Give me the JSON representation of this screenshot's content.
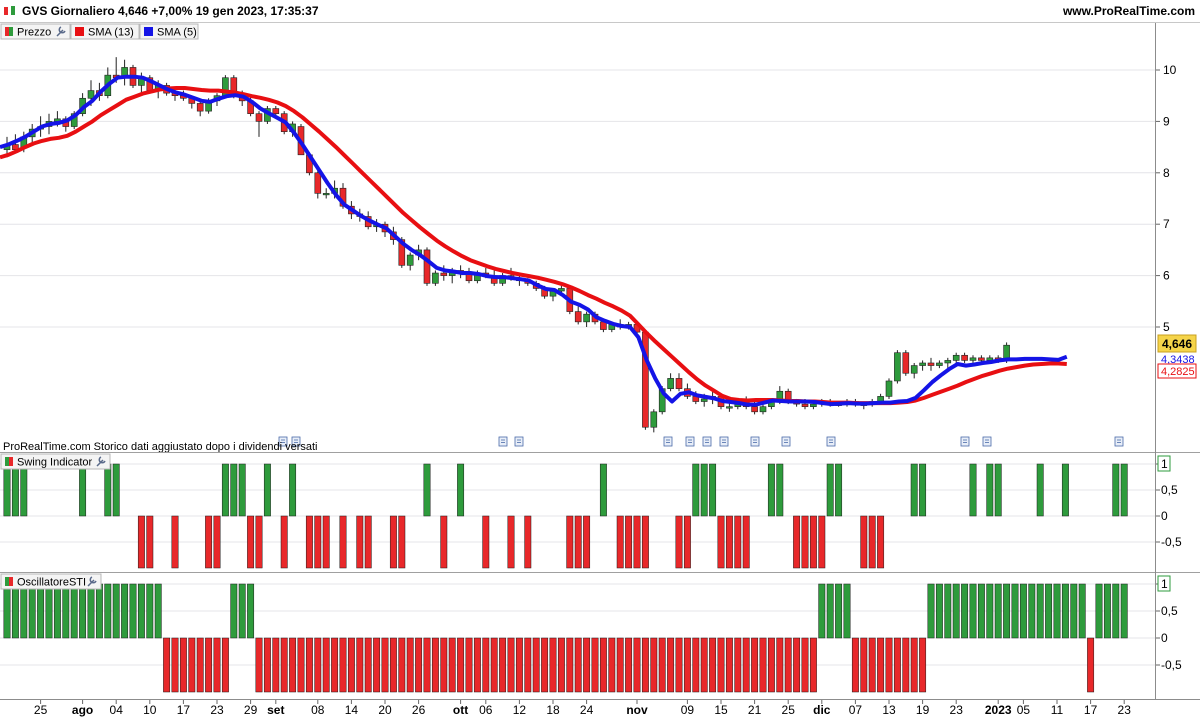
{
  "header": {
    "title": "GVS Giornaliero 4,646 +7,00% 19 gen 2023, 17:35:37",
    "site": "www.ProRealTime.com"
  },
  "colors": {
    "up": "#2e9b3c",
    "down": "#e8282a",
    "sma13": "#e80f12",
    "sma5": "#1414e6",
    "grid": "#e4e4e8",
    "price_label_bg": "#f5d44a"
  },
  "price_panel": {
    "legend": [
      {
        "label": "Prezzo",
        "icon": "candle-legend-icon",
        "wrench": true
      },
      {
        "label": "SMA (13)",
        "color": "#e80f12"
      },
      {
        "label": "SMA (5)",
        "color": "#1414e6"
      }
    ],
    "footnote": "ProRealTime.com  Storico dati aggiustato dopo i dividendi versati",
    "price_tag": "4,646",
    "sma5_tag": "4,3438",
    "sma13_tag": "4,2825",
    "y_ticks": [
      "10",
      "9",
      "8",
      "7",
      "6",
      "5"
    ]
  },
  "swing_panel": {
    "title": "Swing Indicator",
    "y_ticks": [
      "1",
      "0,5",
      "0",
      "-0,5"
    ]
  },
  "sti_panel": {
    "title": "OscillatoreSTI",
    "y_ticks": [
      "1",
      "0,5",
      "0",
      "-0,5"
    ]
  },
  "x_axis": {
    "labels": [
      {
        "text": "25",
        "bar": 4,
        "bold": false
      },
      {
        "text": "ago",
        "bar": 9,
        "bold": true
      },
      {
        "text": "04",
        "bar": 13,
        "bold": false
      },
      {
        "text": "10",
        "bar": 17,
        "bold": false
      },
      {
        "text": "17",
        "bar": 21,
        "bold": false
      },
      {
        "text": "23",
        "bar": 25,
        "bold": false
      },
      {
        "text": "29",
        "bar": 29,
        "bold": false
      },
      {
        "text": "set",
        "bar": 32,
        "bold": true
      },
      {
        "text": "08",
        "bar": 37,
        "bold": false
      },
      {
        "text": "14",
        "bar": 41,
        "bold": false
      },
      {
        "text": "20",
        "bar": 45,
        "bold": false
      },
      {
        "text": "26",
        "bar": 49,
        "bold": false
      },
      {
        "text": "ott",
        "bar": 54,
        "bold": true
      },
      {
        "text": "06",
        "bar": 57,
        "bold": false
      },
      {
        "text": "12",
        "bar": 61,
        "bold": false
      },
      {
        "text": "18",
        "bar": 65,
        "bold": false
      },
      {
        "text": "24",
        "bar": 69,
        "bold": false
      },
      {
        "text": "nov",
        "bar": 75,
        "bold": true
      },
      {
        "text": "09",
        "bar": 81,
        "bold": false
      },
      {
        "text": "15",
        "bar": 85,
        "bold": false
      },
      {
        "text": "21",
        "bar": 89,
        "bold": false
      },
      {
        "text": "25",
        "bar": 93,
        "bold": false
      },
      {
        "text": "dic",
        "bar": 97,
        "bold": true
      },
      {
        "text": "07",
        "bar": 101,
        "bold": false
      },
      {
        "text": "13",
        "bar": 105,
        "bold": false
      },
      {
        "text": "19",
        "bar": 109,
        "bold": false
      },
      {
        "text": "23",
        "bar": 113,
        "bold": false
      },
      {
        "text": "2023",
        "bar": 118,
        "bold": true
      },
      {
        "text": "05",
        "bar": 121,
        "bold": false
      },
      {
        "text": "11",
        "bar": 125,
        "bold": false
      },
      {
        "text": "17",
        "bar": 129,
        "bold": false
      },
      {
        "text": "23",
        "bar": 133,
        "bold": false
      }
    ]
  },
  "chart_data": {
    "type": "candlestick",
    "title": "GVS Giornaliero",
    "ylim": [
      3.0,
      10.5
    ],
    "ohlc": [
      [
        8.45,
        8.7,
        8.3,
        8.55
      ],
      [
        8.55,
        8.75,
        8.4,
        8.45
      ],
      [
        8.5,
        8.8,
        8.4,
        8.7
      ],
      [
        8.7,
        8.95,
        8.55,
        8.85
      ],
      [
        8.85,
        9.1,
        8.7,
        8.9
      ],
      [
        8.9,
        9.15,
        8.75,
        9.0
      ],
      [
        9.0,
        9.2,
        8.9,
        9.05
      ],
      [
        9.05,
        9.1,
        8.8,
        8.9
      ],
      [
        8.9,
        9.2,
        8.85,
        9.15
      ],
      [
        9.15,
        9.55,
        9.1,
        9.45
      ],
      [
        9.45,
        9.8,
        9.3,
        9.6
      ],
      [
        9.6,
        9.75,
        9.4,
        9.5
      ],
      [
        9.5,
        10.05,
        9.45,
        9.9
      ],
      [
        9.9,
        10.25,
        9.75,
        9.85
      ],
      [
        9.85,
        10.2,
        9.7,
        10.05
      ],
      [
        10.05,
        10.1,
        9.65,
        9.7
      ],
      [
        9.7,
        9.95,
        9.55,
        9.85
      ],
      [
        9.85,
        9.9,
        9.55,
        9.6
      ],
      [
        9.6,
        9.8,
        9.45,
        9.7
      ],
      [
        9.7,
        9.75,
        9.5,
        9.55
      ],
      [
        9.55,
        9.65,
        9.4,
        9.5
      ],
      [
        9.5,
        9.6,
        9.4,
        9.45
      ],
      [
        9.45,
        9.5,
        9.25,
        9.35
      ],
      [
        9.35,
        9.4,
        9.1,
        9.2
      ],
      [
        9.2,
        9.45,
        9.15,
        9.4
      ],
      [
        9.4,
        9.55,
        9.3,
        9.5
      ],
      [
        9.5,
        9.9,
        9.45,
        9.85
      ],
      [
        9.85,
        9.9,
        9.45,
        9.5
      ],
      [
        9.5,
        9.6,
        9.3,
        9.4
      ],
      [
        9.4,
        9.5,
        9.1,
        9.15
      ],
      [
        9.15,
        9.2,
        8.7,
        9.0
      ],
      [
        9.0,
        9.3,
        8.95,
        9.25
      ],
      [
        9.25,
        9.3,
        9.1,
        9.15
      ],
      [
        9.15,
        9.2,
        8.75,
        8.8
      ],
      [
        8.8,
        9.0,
        8.7,
        8.95
      ],
      [
        8.9,
        8.95,
        8.35,
        8.35
      ],
      [
        8.35,
        8.4,
        7.95,
        8.0
      ],
      [
        8.0,
        8.1,
        7.5,
        7.6
      ],
      [
        7.6,
        7.7,
        7.5,
        7.6
      ],
      [
        7.6,
        7.85,
        7.5,
        7.7
      ],
      [
        7.7,
        7.8,
        7.3,
        7.35
      ],
      [
        7.35,
        7.45,
        7.1,
        7.2
      ],
      [
        7.2,
        7.3,
        7.05,
        7.15
      ],
      [
        7.15,
        7.25,
        6.9,
        6.95
      ],
      [
        6.95,
        7.1,
        6.85,
        7.0
      ],
      [
        7.0,
        7.05,
        6.75,
        6.85
      ],
      [
        6.85,
        6.95,
        6.6,
        6.7
      ],
      [
        6.7,
        6.75,
        6.15,
        6.2
      ],
      [
        6.2,
        6.45,
        6.1,
        6.4
      ],
      [
        6.4,
        6.6,
        6.3,
        6.5
      ],
      [
        6.5,
        6.55,
        5.8,
        5.85
      ],
      [
        5.85,
        6.1,
        5.8,
        6.05
      ],
      [
        6.05,
        6.2,
        5.9,
        6.0
      ],
      [
        6.0,
        6.15,
        5.85,
        6.1
      ],
      [
        6.1,
        6.2,
        5.95,
        6.05
      ],
      [
        6.05,
        6.15,
        5.85,
        5.9
      ],
      [
        5.9,
        6.1,
        5.85,
        6.05
      ],
      [
        6.05,
        6.15,
        5.95,
        6.0
      ],
      [
        6.0,
        6.1,
        5.8,
        5.85
      ],
      [
        5.85,
        6.05,
        5.8,
        6.0
      ],
      [
        6.0,
        6.15,
        5.9,
        5.95
      ],
      [
        5.95,
        6.05,
        5.8,
        5.9
      ],
      [
        5.9,
        5.95,
        5.8,
        5.85
      ],
      [
        5.85,
        5.9,
        5.7,
        5.75
      ],
      [
        5.75,
        5.8,
        5.55,
        5.6
      ],
      [
        5.6,
        5.75,
        5.5,
        5.7
      ],
      [
        5.7,
        5.8,
        5.6,
        5.75
      ],
      [
        5.75,
        5.8,
        5.25,
        5.3
      ],
      [
        5.3,
        5.4,
        5.05,
        5.1
      ],
      [
        5.1,
        5.3,
        5.0,
        5.25
      ],
      [
        5.25,
        5.3,
        5.05,
        5.1
      ],
      [
        5.1,
        5.15,
        4.9,
        4.95
      ],
      [
        4.95,
        5.1,
        4.9,
        5.05
      ],
      [
        5.05,
        5.15,
        4.95,
        5.0
      ],
      [
        5.0,
        5.1,
        4.95,
        5.05
      ],
      [
        5.05,
        5.1,
        4.85,
        4.9
      ],
      [
        4.9,
        4.95,
        3.0,
        3.05
      ],
      [
        3.05,
        3.4,
        2.95,
        3.35
      ],
      [
        3.35,
        3.85,
        3.3,
        3.8
      ],
      [
        3.8,
        4.1,
        3.75,
        4.0
      ],
      [
        4.0,
        4.1,
        3.75,
        3.8
      ],
      [
        3.8,
        3.9,
        3.6,
        3.65
      ],
      [
        3.65,
        3.75,
        3.5,
        3.55
      ],
      [
        3.55,
        3.7,
        3.45,
        3.6
      ],
      [
        3.6,
        3.75,
        3.5,
        3.65
      ],
      [
        3.65,
        3.7,
        3.4,
        3.45
      ],
      [
        3.45,
        3.55,
        3.35,
        3.45
      ],
      [
        3.45,
        3.6,
        3.4,
        3.55
      ],
      [
        3.55,
        3.65,
        3.4,
        3.45
      ],
      [
        3.45,
        3.55,
        3.3,
        3.35
      ],
      [
        3.35,
        3.5,
        3.3,
        3.45
      ],
      [
        3.45,
        3.6,
        3.4,
        3.55
      ],
      [
        3.55,
        3.85,
        3.5,
        3.75
      ],
      [
        3.75,
        3.8,
        3.5,
        3.55
      ],
      [
        3.55,
        3.6,
        3.45,
        3.5
      ],
      [
        3.5,
        3.6,
        3.4,
        3.45
      ],
      [
        3.45,
        3.55,
        3.4,
        3.5
      ],
      [
        3.5,
        3.6,
        3.45,
        3.55
      ],
      [
        3.55,
        3.6,
        3.45,
        3.5
      ],
      [
        3.5,
        3.55,
        3.45,
        3.5
      ],
      [
        3.5,
        3.6,
        3.45,
        3.55
      ],
      [
        3.55,
        3.6,
        3.45,
        3.5
      ],
      [
        3.5,
        3.55,
        3.4,
        3.5
      ],
      [
        3.5,
        3.6,
        3.45,
        3.55
      ],
      [
        3.55,
        3.7,
        3.5,
        3.65
      ],
      [
        3.65,
        4.0,
        3.6,
        3.95
      ],
      [
        3.95,
        4.55,
        3.9,
        4.5
      ],
      [
        4.5,
        4.55,
        4.05,
        4.1
      ],
      [
        4.1,
        4.3,
        4.0,
        4.25
      ],
      [
        4.25,
        4.35,
        4.15,
        4.3
      ],
      [
        4.3,
        4.4,
        4.15,
        4.25
      ],
      [
        4.25,
        4.35,
        4.2,
        4.3
      ],
      [
        4.3,
        4.4,
        4.2,
        4.35
      ],
      [
        4.35,
        4.5,
        4.3,
        4.45
      ],
      [
        4.45,
        4.5,
        4.3,
        4.35
      ],
      [
        4.35,
        4.45,
        4.25,
        4.4
      ],
      [
        4.4,
        4.45,
        4.3,
        4.35
      ],
      [
        4.35,
        4.45,
        4.3,
        4.4
      ],
      [
        4.4,
        4.45,
        4.3,
        4.35
      ],
      [
        4.35,
        4.7,
        4.3,
        4.646
      ]
    ],
    "sma13": [
      8.3,
      8.35,
      8.42,
      8.5,
      8.57,
      8.62,
      8.66,
      8.68,
      8.72,
      8.8,
      8.9,
      9.0,
      9.12,
      9.22,
      9.32,
      9.42,
      9.48,
      9.54,
      9.58,
      9.62,
      9.64,
      9.65,
      9.65,
      9.63,
      9.61,
      9.6,
      9.6,
      9.58,
      9.56,
      9.53,
      9.49,
      9.46,
      9.42,
      9.37,
      9.3,
      9.2,
      9.08,
      8.94,
      8.8,
      8.65,
      8.5,
      8.34,
      8.18,
      8.02,
      7.86,
      7.7,
      7.54,
      7.38,
      7.22,
      7.08,
      6.94,
      6.81,
      6.68,
      6.57,
      6.47,
      6.38,
      6.3,
      6.24,
      6.18,
      6.13,
      6.09,
      6.05,
      6.02,
      5.99,
      5.96,
      5.92,
      5.88,
      5.83,
      5.77,
      5.7,
      5.62,
      5.55,
      5.47,
      5.4,
      5.32,
      5.22,
      5.05,
      4.88,
      4.72,
      4.57,
      4.42,
      4.27,
      4.12,
      3.98,
      3.86,
      3.76,
      3.66,
      3.6,
      3.58,
      3.57,
      3.58,
      3.58,
      3.58,
      3.57,
      3.56,
      3.56,
      3.55,
      3.55,
      3.54,
      3.53,
      3.53,
      3.53,
      3.52,
      3.52,
      3.52,
      3.52,
      3.52,
      3.53,
      3.54,
      3.57,
      3.62,
      3.68,
      3.74,
      3.8,
      3.86,
      3.93,
      3.99,
      4.05,
      4.1,
      4.15,
      4.19,
      4.22,
      4.25,
      4.27,
      4.28,
      4.29,
      4.29,
      4.28
    ],
    "sma5": [
      8.5,
      8.55,
      8.62,
      8.7,
      8.8,
      8.9,
      8.95,
      8.97,
      9.02,
      9.12,
      9.28,
      9.4,
      9.58,
      9.73,
      9.85,
      9.87,
      9.87,
      9.85,
      9.78,
      9.7,
      9.62,
      9.56,
      9.52,
      9.46,
      9.4,
      9.38,
      9.44,
      9.49,
      9.51,
      9.48,
      9.38,
      9.25,
      9.16,
      9.07,
      8.98,
      8.78,
      8.55,
      8.3,
      8.05,
      7.8,
      7.57,
      7.38,
      7.27,
      7.16,
      7.07,
      6.99,
      6.92,
      6.77,
      6.62,
      6.5,
      6.4,
      6.28,
      6.15,
      6.1,
      6.08,
      6.05,
      6.05,
      6.03,
      5.99,
      5.97,
      5.97,
      5.95,
      5.93,
      5.9,
      5.81,
      5.74,
      5.72,
      5.62,
      5.49,
      5.43,
      5.34,
      5.19,
      5.12,
      5.06,
      5.02,
      5.0,
      4.8,
      4.35,
      4.0,
      3.71,
      3.55,
      3.7,
      3.73,
      3.67,
      3.64,
      3.61,
      3.56,
      3.54,
      3.52,
      3.49,
      3.49,
      3.53,
      3.57,
      3.56,
      3.55,
      3.55,
      3.55,
      3.54,
      3.52,
      3.5,
      3.51,
      3.52,
      3.51,
      3.51,
      3.52,
      3.53,
      3.53,
      3.55,
      3.56,
      3.62,
      3.77,
      3.93,
      4.06,
      4.18,
      4.28,
      4.25,
      4.27,
      4.3,
      4.32,
      4.35,
      4.37,
      4.37,
      4.38,
      4.38,
      4.38,
      4.37,
      4.36,
      4.42
    ],
    "swing": [
      1,
      1,
      1,
      0,
      0,
      0,
      0,
      0,
      0,
      1,
      0,
      0,
      1,
      1,
      0,
      0,
      -1,
      -1,
      0,
      0,
      -1,
      0,
      0,
      0,
      -1,
      -1,
      1,
      1,
      1,
      -1,
      -1,
      1,
      0,
      -1,
      1,
      0,
      -1,
      -1,
      -1,
      0,
      -1,
      0,
      -1,
      -1,
      0,
      0,
      -1,
      -1,
      0,
      0,
      1,
      0,
      -1,
      0,
      1,
      0,
      0,
      -1,
      0,
      0,
      -1,
      0,
      -1,
      0,
      0,
      0,
      0,
      -1,
      -1,
      -1,
      0,
      1,
      0,
      -1,
      -1,
      -1,
      -1,
      0,
      0,
      0,
      -1,
      -1,
      1,
      1,
      1,
      -1,
      -1,
      -1,
      -1,
      0,
      0,
      1,
      1,
      0,
      -1,
      -1,
      -1,
      -1,
      1,
      1,
      0,
      0,
      -1,
      -1,
      -1,
      0,
      0,
      0,
      1,
      1,
      0,
      0,
      0,
      0,
      0,
      1,
      0,
      1,
      1,
      0,
      0,
      0,
      0,
      1,
      0,
      0,
      1,
      0,
      0,
      0,
      0,
      0,
      1,
      1
    ],
    "sti": [
      1,
      1,
      1,
      1,
      1,
      1,
      1,
      1,
      1,
      1,
      1,
      1,
      1,
      1,
      1,
      1,
      1,
      1,
      1,
      -1,
      -1,
      -1,
      -1,
      -1,
      -1,
      -1,
      -1,
      1,
      1,
      1,
      -1,
      -1,
      -1,
      -1,
      -1,
      -1,
      -1,
      -1,
      -1,
      -1,
      -1,
      -1,
      -1,
      -1,
      -1,
      -1,
      -1,
      -1,
      -1,
      -1,
      -1,
      -1,
      -1,
      -1,
      -1,
      -1,
      -1,
      -1,
      -1,
      -1,
      -1,
      -1,
      -1,
      -1,
      -1,
      -1,
      -1,
      -1,
      -1,
      -1,
      -1,
      -1,
      -1,
      -1,
      -1,
      -1,
      -1,
      -1,
      -1,
      -1,
      -1,
      -1,
      -1,
      -1,
      -1,
      -1,
      -1,
      -1,
      -1,
      -1,
      -1,
      -1,
      -1,
      -1,
      -1,
      -1,
      -1,
      1,
      1,
      1,
      1,
      -1,
      -1,
      -1,
      -1,
      -1,
      -1,
      -1,
      -1,
      -1,
      1,
      1,
      1,
      1,
      1,
      1,
      1,
      1,
      1,
      1,
      1,
      1,
      1,
      1,
      1,
      1,
      1,
      1,
      1,
      -1,
      1,
      1,
      1,
      1
    ]
  }
}
